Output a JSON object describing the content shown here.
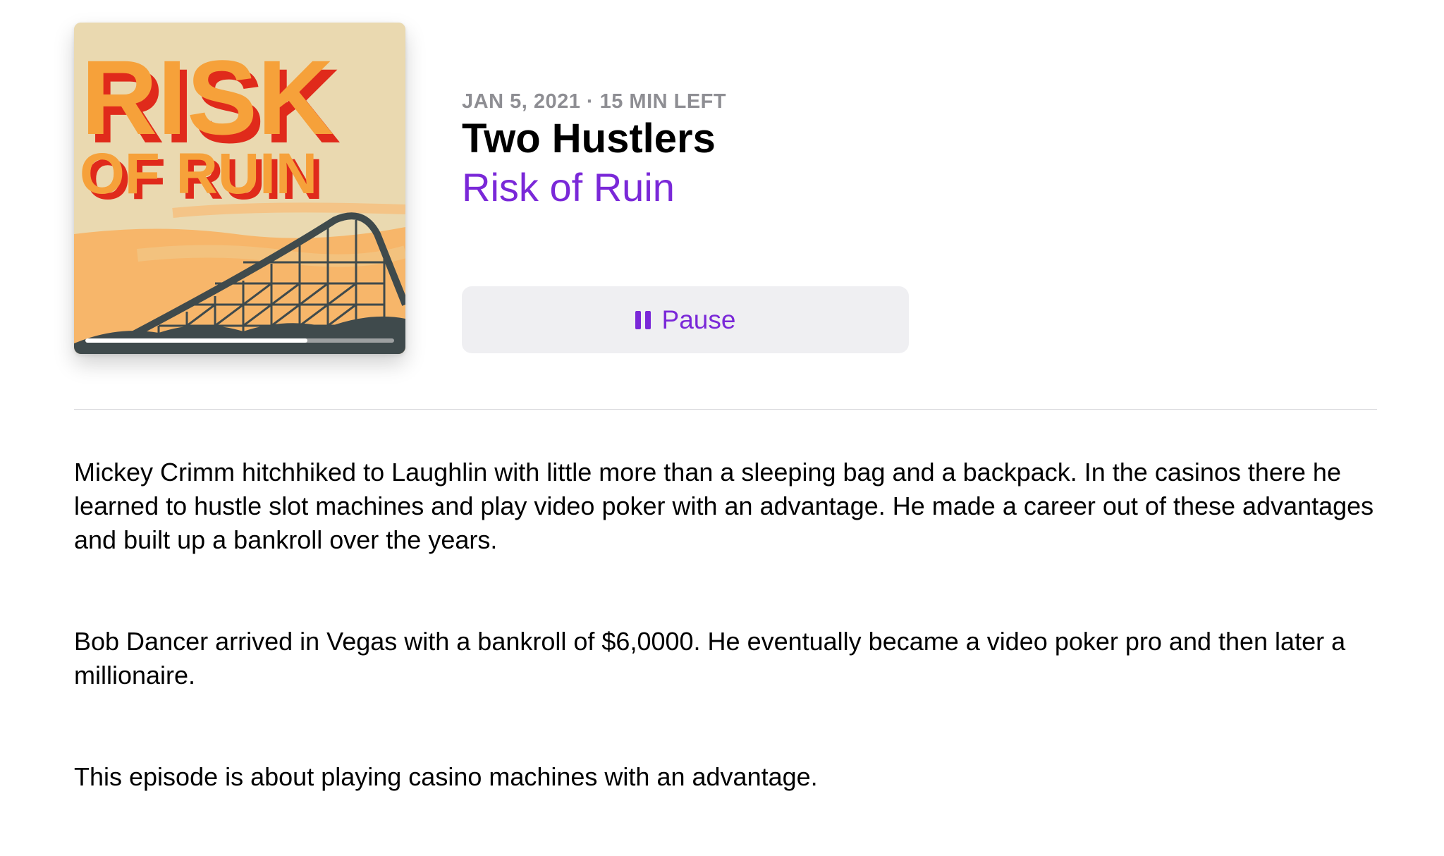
{
  "artwork": {
    "title_line1": "RISK",
    "title_line2": "OF RUIN",
    "progress_fraction": 0.72,
    "colors": {
      "bg": "#ead9b0",
      "orange": "#f6a13a",
      "red": "#e02a1b",
      "dark": "#3f4a4c",
      "sun": "#f7b66a"
    }
  },
  "episode": {
    "date_line": "JAN 5, 2021 · 15 MIN LEFT",
    "title": "Two Hustlers",
    "show": "Risk of Ruin"
  },
  "controls": {
    "pause_label": "Pause",
    "pause_icon": "pause-icon"
  },
  "description": {
    "paragraphs": [
      "Mickey Crimm hitchhiked to Laughlin with little more than a sleeping bag and a backpack. In the casinos there he learned to hustle slot machines and play video poker with an advantage. He made a career out of these advantages and built up a bankroll over the years.",
      "Bob Dancer arrived in Vegas with a bankroll of $6,0000. He eventually became a video poker pro and then later a millionaire.",
      "This episode is about playing casino machines with an advantage."
    ]
  },
  "theme": {
    "accent": "#7a28d8",
    "secondary_text": "#8e8e93",
    "button_bg": "#efeff2"
  }
}
